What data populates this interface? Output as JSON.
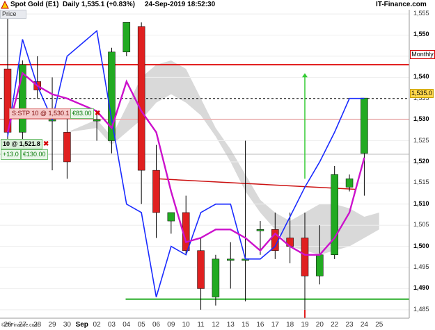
{
  "header": {
    "instrument": "Spot Gold (E1)",
    "timeframe": "Daily",
    "last_change": "1,535.1 (+0.83%)",
    "datetime": "24-Sep-2019 18:52:30",
    "brand": "IT-Finance.com",
    "brand_icon": "triangle-logo-icon"
  },
  "panel": {
    "price_tab": "Price"
  },
  "orders": {
    "stop_label": "S:STP  10 @ 1,530.1",
    "stop_value": "€83.00",
    "close_icon": "close-x-icon",
    "position_label": "10 @ 1,521.8",
    "position_pnl_points": "+13.0",
    "position_pnl_money": "€130.00"
  },
  "y_axis": {
    "ticks": [
      "1,555",
      "1,550",
      "1,545",
      "1,540",
      "1,535",
      "1,530",
      "1,525",
      "1,520",
      "1,515",
      "1,510",
      "1,505",
      "1,500",
      "1,495",
      "1,490",
      "1,485"
    ],
    "bold_ticks": [
      "1,550",
      "1,540",
      "1,530",
      "1,520",
      "1,510",
      "1,500",
      "1,490"
    ],
    "monthly_label": "Monthly",
    "current_price_label": "1,535.0"
  },
  "x_axis": {
    "labels": [
      "26",
      "27",
      "28",
      "29",
      "30",
      "Sep",
      "02",
      "03",
      "04",
      "05",
      "06",
      "09",
      "10",
      "11",
      "12",
      "13",
      "15",
      "16",
      "17",
      "18",
      "19",
      "20",
      "22",
      "23",
      "24",
      "25"
    ],
    "bold_labels": [
      "Sep"
    ]
  },
  "footer": {
    "brand": "©IT-Finance.com"
  },
  "colors": {
    "bull": "#22aa22",
    "bear": "#e02020",
    "blue_line": "#1a2bff",
    "magenta_line": "#cc11cc",
    "cloud": "#cccccc",
    "monthly_line": "#e01010",
    "support_line": "#22aa22",
    "current_price_box": "#ffd84d"
  },
  "chart_data": {
    "type": "candlestick",
    "y_range": [
      1483,
      1556
    ],
    "dates": [
      "26",
      "27",
      "28",
      "29",
      "30",
      "02",
      "03",
      "04",
      "05",
      "06",
      "09",
      "10",
      "11",
      "12",
      "13",
      "15",
      "16",
      "17",
      "18",
      "19",
      "20",
      "22",
      "23",
      "24"
    ],
    "candles": [
      {
        "date": "26",
        "open": 1542.0,
        "high": 1554.0,
        "low": 1524.0,
        "close": 1527.0
      },
      {
        "date": "27",
        "open": 1527.0,
        "high": 1544.0,
        "low": 1525.0,
        "close": 1543.0
      },
      {
        "date": "28",
        "open": 1539.0,
        "high": 1545.0,
        "low": 1535.0,
        "close": 1537.0
      },
      {
        "date": "29",
        "open": 1530.0,
        "high": 1540.0,
        "low": 1518.0,
        "close": 1530.0
      },
      {
        "date": "30",
        "open": 1527.0,
        "high": 1532.0,
        "low": 1516.0,
        "close": 1520.0
      },
      {
        "date": "02",
        "open": 1530.0,
        "high": 1532.0,
        "low": 1525.0,
        "close": 1530.0
      },
      {
        "date": "03",
        "open": 1525.0,
        "high": 1547.0,
        "low": 1522.0,
        "close": 1546.0
      },
      {
        "date": "04",
        "open": 1546.0,
        "high": 1553.0,
        "low": 1545.0,
        "close": 1553.0
      },
      {
        "date": "05",
        "open": 1552.0,
        "high": 1553.0,
        "low": 1510.0,
        "close": 1518.0
      },
      {
        "date": "06",
        "open": 1518.0,
        "high": 1524.0,
        "low": 1502.0,
        "close": 1508.0
      },
      {
        "date": "09",
        "open": 1506.0,
        "high": 1508.0,
        "low": 1503.0,
        "close": 1508.0
      },
      {
        "date": "10",
        "open": 1508.0,
        "high": 1512.0,
        "low": 1498.0,
        "close": 1499.0
      },
      {
        "date": "11",
        "open": 1499.0,
        "high": 1502.0,
        "low": 1485.0,
        "close": 1490.0
      },
      {
        "date": "12",
        "open": 1488.0,
        "high": 1498.0,
        "low": 1486.0,
        "close": 1497.0
      },
      {
        "date": "13",
        "open": 1497.0,
        "high": 1501.0,
        "low": 1490.0,
        "close": 1497.0
      },
      {
        "date": "15",
        "open": 1497.0,
        "high": 1525.0,
        "low": 1487.0,
        "close": 1497.0
      },
      {
        "date": "16",
        "open": 1504.0,
        "high": 1506.0,
        "low": 1498.0,
        "close": 1504.0
      },
      {
        "date": "17",
        "open": 1504.0,
        "high": 1508.0,
        "low": 1497.0,
        "close": 1499.0
      },
      {
        "date": "18",
        "open": 1502.0,
        "high": 1508.0,
        "low": 1496.0,
        "close": 1500.0
      },
      {
        "date": "19",
        "open": 1502.0,
        "high": 1508.0,
        "low": 1485.0,
        "close": 1493.0
      },
      {
        "date": "20",
        "open": 1493.0,
        "high": 1505.0,
        "low": 1491.0,
        "close": 1498.0
      },
      {
        "date": "22",
        "open": 1498.0,
        "high": 1519.0,
        "low": 1497.0,
        "close": 1517.0
      },
      {
        "date": "23",
        "open": 1514.0,
        "high": 1517.0,
        "low": 1513.0,
        "close": 1516.0
      },
      {
        "date": "24",
        "open": 1522.0,
        "high": 1527.0,
        "low": 1512.0,
        "close": 1535.1
      }
    ],
    "blue_line": {
      "x": [
        "26",
        "27",
        "28",
        "29",
        "30",
        "02",
        "03",
        "04",
        "05",
        "06",
        "09",
        "10",
        "11",
        "12",
        "13",
        "15",
        "16",
        "17",
        "18",
        "19",
        "20",
        "22",
        "23",
        "24"
      ],
      "y": [
        1526,
        1549,
        1538,
        1530,
        1545,
        1551,
        1530,
        1510,
        1508,
        1488,
        1500,
        1498,
        1508,
        1510,
        1510,
        1497,
        1497,
        1500,
        1507,
        1514,
        1520,
        1527,
        1535,
        1535
      ]
    },
    "magenta_line": {
      "x": [
        "26",
        "27",
        "28",
        "29",
        "30",
        "02",
        "03",
        "04",
        "05",
        "06",
        "09",
        "10",
        "11",
        "12",
        "13",
        "15",
        "16",
        "17",
        "18",
        "19",
        "20",
        "22",
        "23",
        "24"
      ],
      "y": [
        1527,
        1541,
        1538,
        1536,
        1535,
        1532,
        1528,
        1539,
        1532,
        1527,
        1513,
        1501,
        1502,
        1504,
        1504,
        1502,
        1499,
        1503,
        1500,
        1498,
        1498,
        1502,
        1508,
        1521
      ]
    },
    "cloud_top": {
      "x": [
        "30",
        "02",
        "03",
        "04",
        "05",
        "06",
        "09",
        "10",
        "11",
        "12",
        "13",
        "15",
        "16",
        "17",
        "18",
        "19",
        "20",
        "22",
        "23",
        "24",
        "25"
      ],
      "y": [
        1527,
        1530,
        1526,
        1533,
        1540,
        1543,
        1544,
        1542,
        1535,
        1528,
        1523,
        1517,
        1511,
        1508,
        1506,
        1508,
        1510,
        1510,
        1509,
        1507,
        1508
      ]
    },
    "cloud_bottom": {
      "x": [
        "30",
        "02",
        "03",
        "04",
        "05",
        "06",
        "09",
        "10",
        "11",
        "12",
        "13",
        "15",
        "16",
        "17",
        "18",
        "19",
        "20",
        "22",
        "23",
        "24",
        "25"
      ],
      "y": [
        1527,
        1528,
        1524,
        1527,
        1530,
        1534,
        1536,
        1534,
        1531,
        1526,
        1520,
        1513,
        1508,
        1504,
        1500,
        1499,
        1498,
        1499,
        1500,
        1502,
        1504
      ]
    },
    "horizontal_lines": [
      {
        "name": "monthly_resistance",
        "price": 1543.0
      },
      {
        "name": "current_price",
        "price": 1535.0,
        "style": "dashed"
      },
      {
        "name": "stop",
        "price": 1530.1
      },
      {
        "name": "entry",
        "price": 1521.8
      },
      {
        "name": "support",
        "price": 1487.5
      }
    ],
    "trend_line": {
      "from": [
        "06",
        1516.0
      ],
      "to": [
        "22",
        1513.5
      ]
    },
    "target_arrow": {
      "at": "19",
      "from": 1516.0,
      "to": 1541.0
    }
  }
}
